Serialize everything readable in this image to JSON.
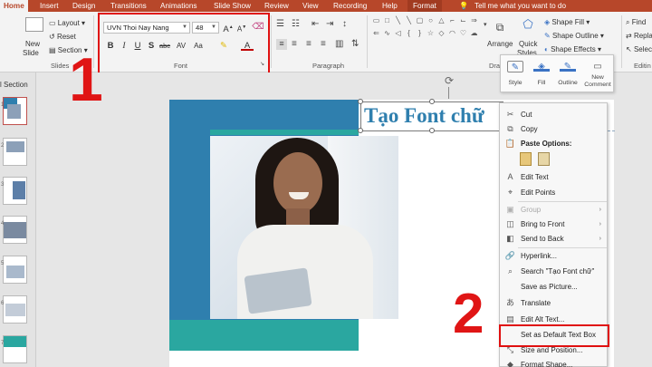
{
  "tabs": [
    "Home",
    "Insert",
    "Design",
    "Transitions",
    "Animations",
    "Slide Show",
    "Review",
    "View",
    "Recording",
    "Help",
    "Format"
  ],
  "tell_me": "Tell me what you want to do",
  "ribbon": {
    "new_slide": "New",
    "new_slide2": "Slide",
    "layout": "Layout",
    "reset": "Reset",
    "section": "Section",
    "slides_group": "Slides",
    "font_name": "UVN Thoi Nay Nang",
    "font_size": "48",
    "font_group": "Font",
    "paragraph_group": "Paragraph",
    "drawing_group": "Drawing",
    "arrange": "Arrange",
    "quick": "Quick",
    "styles": "Styles",
    "shape_fill": "Shape Fill",
    "shape_outline": "Shape Outline",
    "shape_effects": "Shape Effects",
    "find": "Find",
    "replace": "Replace",
    "select": "Select",
    "editing_group": "Editin"
  },
  "left_pane": {
    "section_label": "l Section",
    "numbers": [
      "1",
      "2",
      "3",
      "4",
      "5",
      "6",
      "7"
    ]
  },
  "slide": {
    "title_text": "Tạo Font chữ"
  },
  "mini_toolbar": {
    "style": "Style",
    "fill": "Fill",
    "outline": "Outline",
    "new_comment_1": "New",
    "new_comment_2": "Comment"
  },
  "menu": {
    "cut": "Cut",
    "copy": "Copy",
    "paste_options": "Paste Options:",
    "edit_text": "Edit Text",
    "edit_points": "Edit Points",
    "group": "Group",
    "bring_to_front": "Bring to Front",
    "send_to_back": "Send to Back",
    "hyperlink": "Hyperlink...",
    "search": "Search \"Tạo Font chữ\"",
    "save_as_picture": "Save as Picture...",
    "translate": "Translate",
    "edit_alt_text": "Edit Alt Text...",
    "set_default": "Set as Default Text Box",
    "size_position": "Size and Position...",
    "format_shape": "Format Shape..."
  },
  "annotations": {
    "one": "1",
    "two": "2"
  },
  "colors": {
    "accent": "#b7472a",
    "slide_blue": "#2f7fae",
    "slide_teal": "#2aa7a0",
    "highlight": "#e01010"
  }
}
